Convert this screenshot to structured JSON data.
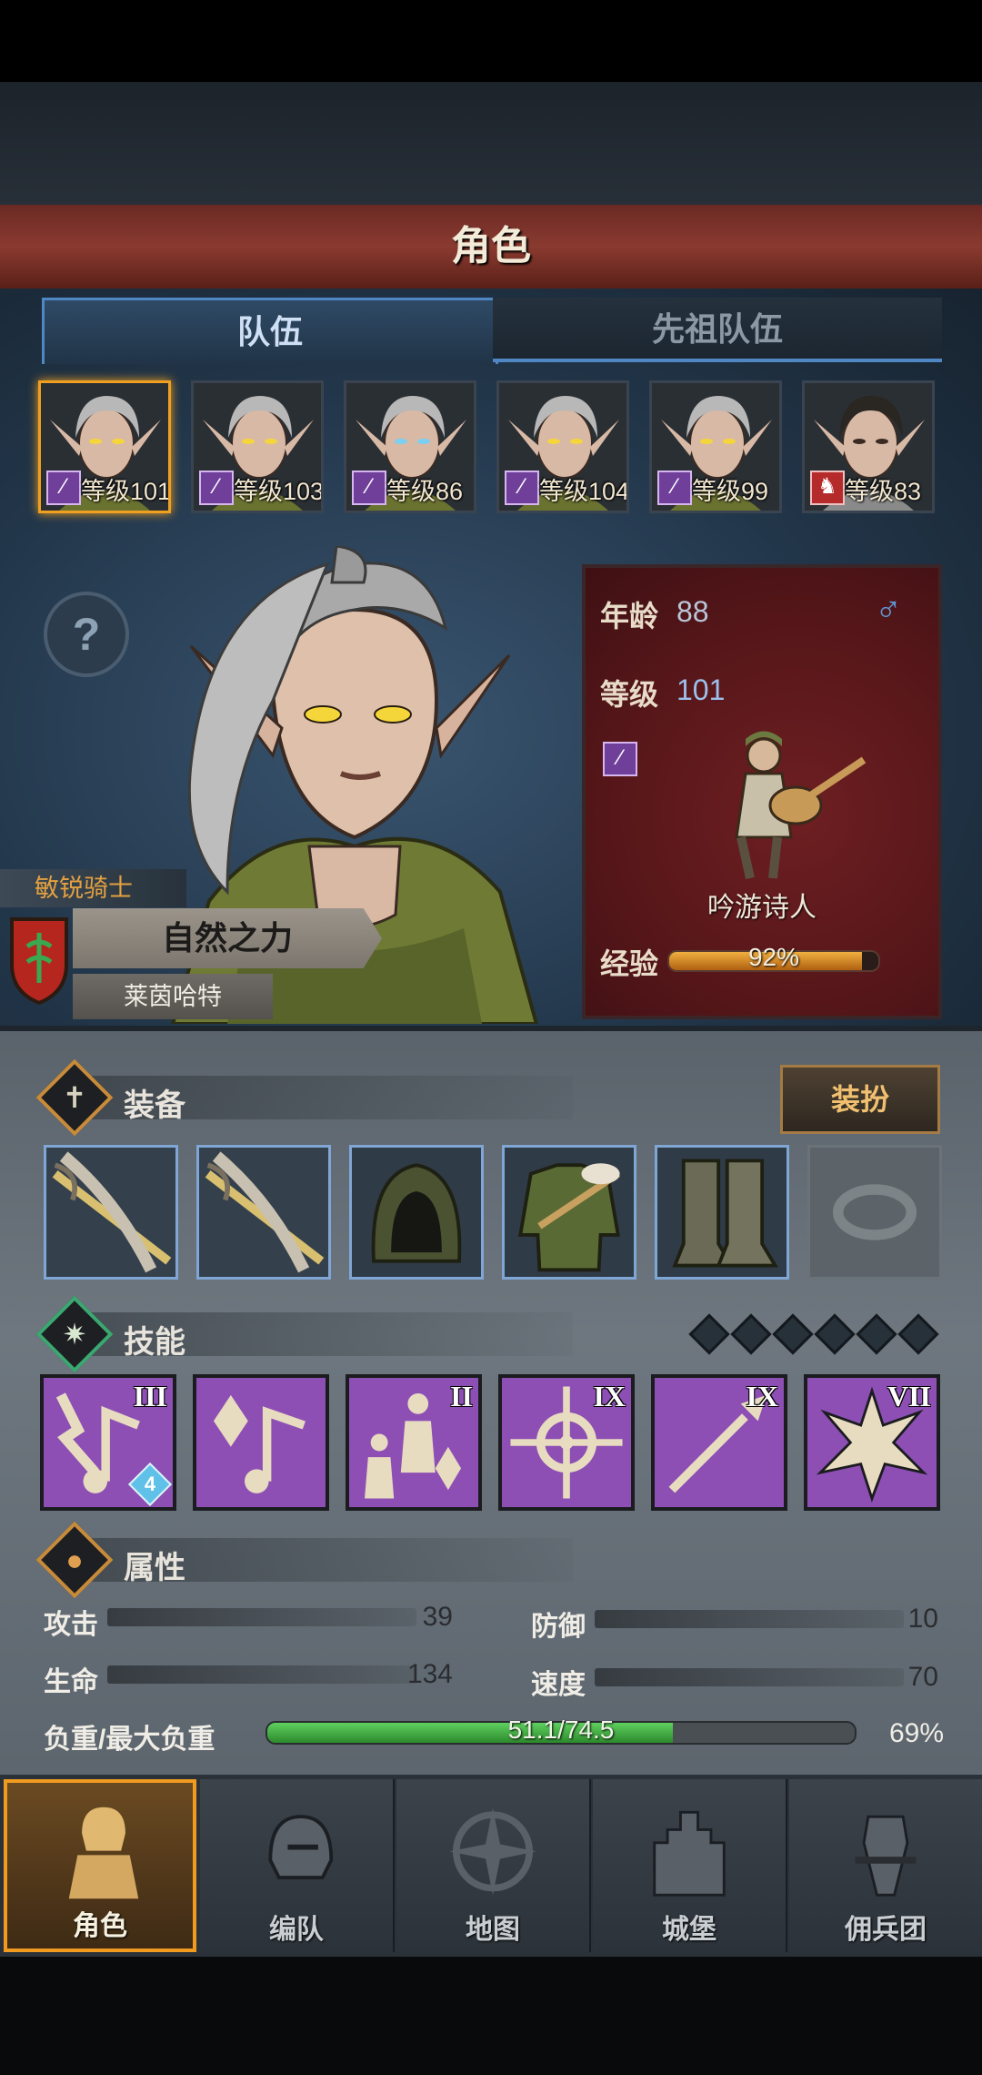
{
  "header": {
    "title": "角色"
  },
  "tabs": [
    {
      "label": "队伍",
      "active": true
    },
    {
      "label": "先祖队伍",
      "active": false
    }
  ],
  "party": [
    {
      "level_text": "等级101",
      "class_icon": "staff-icon",
      "selected": true
    },
    {
      "level_text": "等级103",
      "class_icon": "staff-icon",
      "selected": false
    },
    {
      "level_text": "等级86",
      "class_icon": "staff-icon",
      "selected": false
    },
    {
      "level_text": "等级104",
      "class_icon": "staff-icon",
      "selected": false
    },
    {
      "level_text": "等级99",
      "class_icon": "staff-icon",
      "selected": false
    },
    {
      "level_text": "等级83",
      "class_icon": "bear-icon",
      "selected": false
    }
  ],
  "character": {
    "title_tag": "敏锐骑士",
    "name": "自然之力",
    "region": "莱茵哈特",
    "age_label": "年龄",
    "age": "88",
    "gender_icon": "male-icon",
    "level_label": "等级",
    "level": "101",
    "class_name": "吟游诗人",
    "exp_label": "经验",
    "exp_text": "92%",
    "exp_fraction": 0.92
  },
  "equipment": {
    "title": "装备",
    "dress_button": "装扮",
    "slots": [
      "crossbow-icon",
      "crossbow-icon",
      "hood-icon",
      "tunic-icon",
      "boots-icon",
      "ring-icon"
    ]
  },
  "skills": {
    "title": "技能",
    "gem_count": 6,
    "slots": [
      {
        "icon": "song-icon",
        "rank": "III",
        "badge": "4"
      },
      {
        "icon": "crystal-song-icon",
        "rank": "",
        "badge": ""
      },
      {
        "icon": "party-crystal-icon",
        "rank": "II",
        "badge": ""
      },
      {
        "icon": "target-icon",
        "rank": "IX",
        "badge": ""
      },
      {
        "icon": "spear-icon",
        "rank": "IX",
        "badge": ""
      },
      {
        "icon": "burst-icon",
        "rank": "VII",
        "badge": ""
      }
    ]
  },
  "attributes": {
    "title": "属性",
    "attack_label": "攻击",
    "attack": "39",
    "defense_label": "防御",
    "defense": "10",
    "life_label": "生命",
    "life": "134",
    "speed_label": "速度",
    "speed": "70",
    "load_label": "负重/最大负重",
    "load_text": "51.1/74.5",
    "load_pct": "69%",
    "load_fraction": 0.69
  },
  "nav": [
    {
      "label": "角色",
      "icon": "knight-icon",
      "active": true
    },
    {
      "label": "编队",
      "icon": "helmet-icon",
      "active": false
    },
    {
      "label": "地图",
      "icon": "compass-icon",
      "active": false
    },
    {
      "label": "城堡",
      "icon": "castle-icon",
      "active": false
    },
    {
      "label": "佣兵团",
      "icon": "mercenary-icon",
      "active": false
    }
  ],
  "colors": {
    "banner": "#8a3a30",
    "accent": "#f0a020",
    "class_purple": "#6f3f9a",
    "load_green": "#3aa83a"
  }
}
